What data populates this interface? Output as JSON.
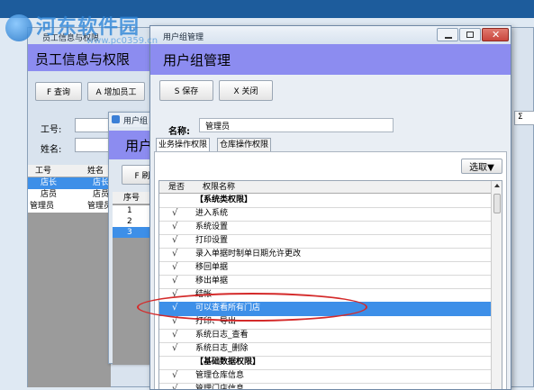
{
  "watermark": {
    "line1": "河东软件园",
    "line2": "www.pc0359.cn"
  },
  "bg_window": {
    "title": "员工信息与权限",
    "heading": "员工信息与权限",
    "btn_query": "F 查询",
    "btn_add": "A 增加员工",
    "label_id": "工号:",
    "label_name": "姓名:",
    "columns": [
      "工号",
      "姓名"
    ],
    "rows": [
      {
        "id": "店长",
        "name": "店长"
      },
      {
        "id": "店员",
        "name": "店员"
      },
      {
        "id": "管理员",
        "name": "管理员"
      }
    ]
  },
  "mid_window": {
    "title": "用户组",
    "heading": "用户",
    "btn": "F 刷",
    "col_no": "序号",
    "rows": [
      "1",
      "2",
      "3"
    ]
  },
  "dialog": {
    "title": "用户组管理",
    "heading": "用户组管理",
    "btn_save": "S 保存",
    "btn_close": "X 关闭",
    "name_label": "名称:",
    "name_value": "管理员",
    "tabs": [
      "业务操作权限",
      "仓库操作权限"
    ],
    "select_label": "选取▼",
    "columns": [
      "是否",
      "权限名称"
    ],
    "rows": [
      {
        "check": "",
        "name": "【系统类权限】",
        "group": true
      },
      {
        "check": "√",
        "name": "进入系统"
      },
      {
        "check": "√",
        "name": "系统设置"
      },
      {
        "check": "√",
        "name": "打印设置"
      },
      {
        "check": "√",
        "name": "录入单据时制单日期允许更改"
      },
      {
        "check": "√",
        "name": "移回单据"
      },
      {
        "check": "√",
        "name": "移出单据"
      },
      {
        "check": "√",
        "name": "结帐"
      },
      {
        "check": "√",
        "name": "可以查看所有门店",
        "selected": true
      },
      {
        "check": "√",
        "name": "打印、导出"
      },
      {
        "check": "√",
        "name": "系统日志_查看"
      },
      {
        "check": "√",
        "name": "系统日志_删除"
      },
      {
        "check": "",
        "name": "【基础数据权限】",
        "group": true
      },
      {
        "check": "√",
        "name": "管理仓库信息"
      },
      {
        "check": "√",
        "name": "管理门店信息"
      }
    ]
  },
  "colors": {
    "header": "#8c8cf0",
    "selection": "#3d8fe8",
    "highlight_ellipse": "#d42a2a",
    "close_button": "#c9463d"
  }
}
